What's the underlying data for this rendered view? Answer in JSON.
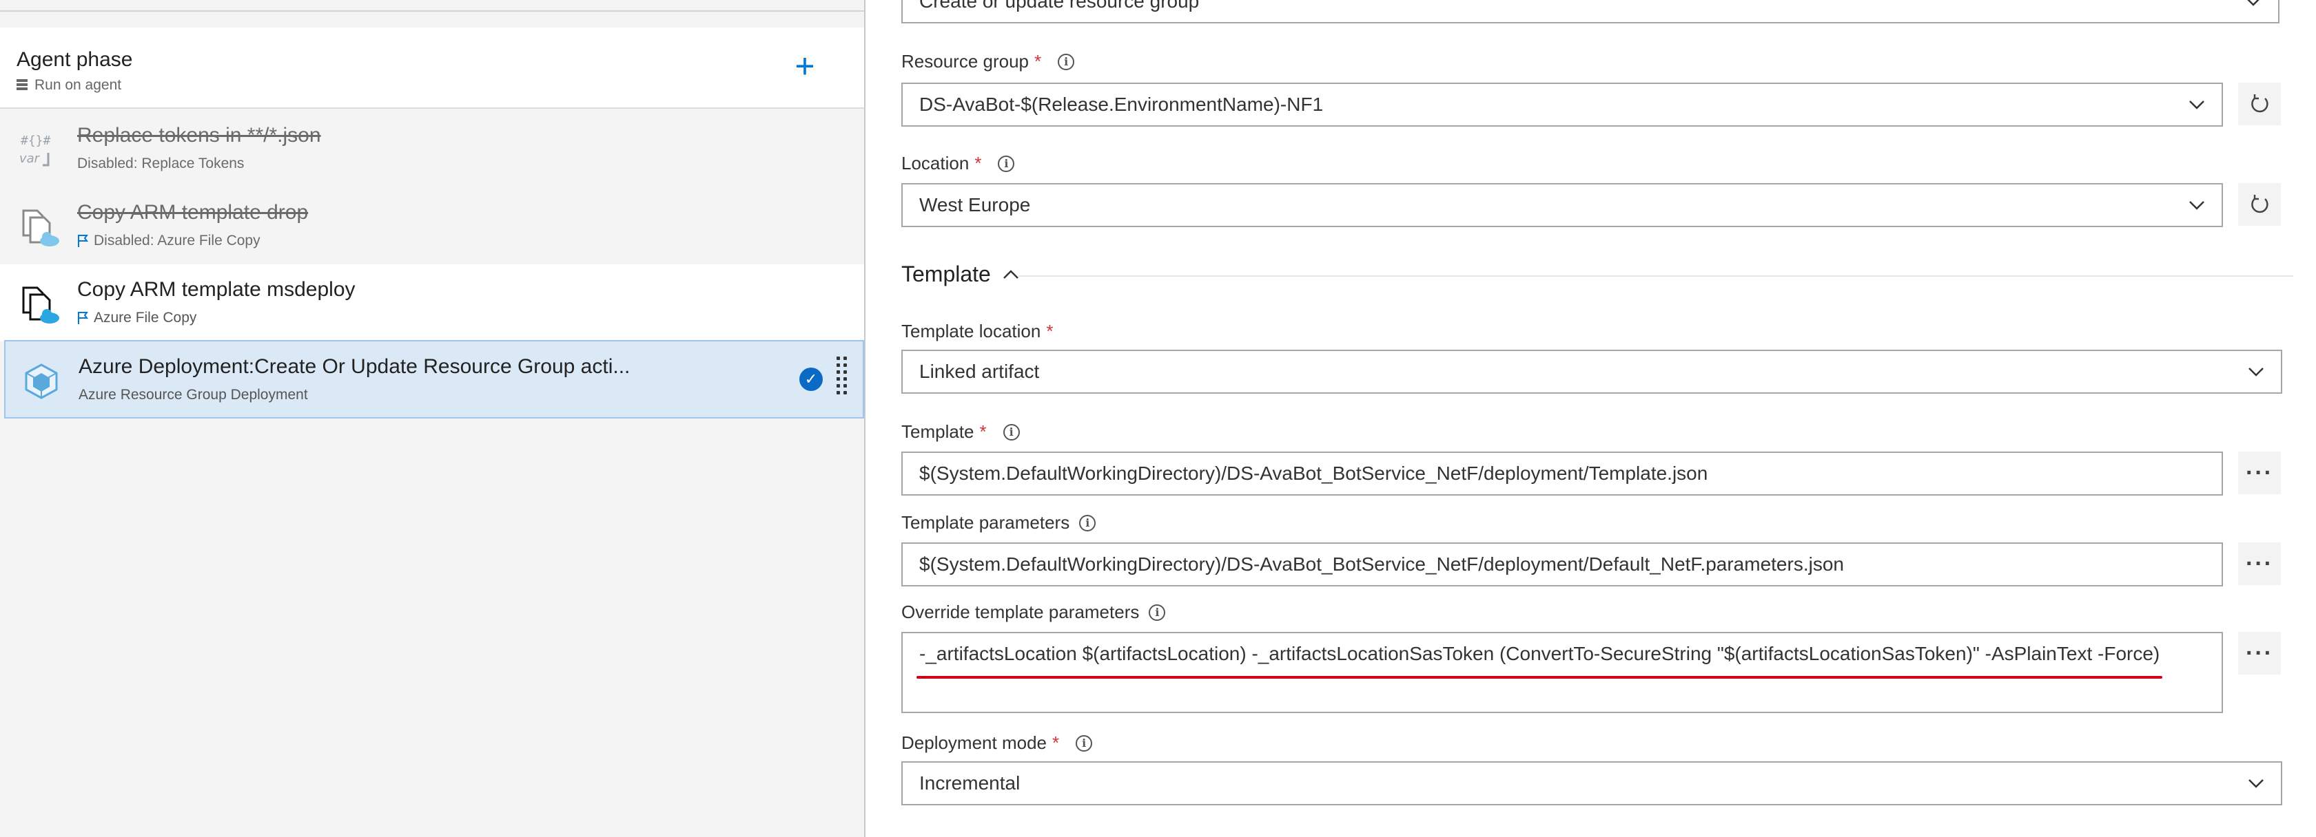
{
  "phase": {
    "title": "Agent phase",
    "subtitle": "Run on agent",
    "add_label": "+"
  },
  "tasks": [
    {
      "name": "Replace tokens in **/*.json",
      "sub": "Disabled: Replace Tokens",
      "icon": "replace-tokens-icon",
      "disabled": true
    },
    {
      "name": "Copy ARM template drop",
      "sub": "Disabled: Azure File Copy",
      "icon": "azure-file-copy-icon",
      "disabled": true
    },
    {
      "name": "Copy ARM template msdeploy",
      "sub": "Azure File Copy",
      "icon": "azure-file-copy-icon",
      "disabled": false
    },
    {
      "name": "Azure Deployment:Create Or Update Resource Group acti...",
      "sub": "Azure Resource Group Deployment",
      "icon": "azure-resource-group-icon",
      "selected": true
    }
  ],
  "form": {
    "action": {
      "value": "Create or update resource group"
    },
    "resource_group": {
      "label": "Resource group",
      "required": "*",
      "value": "DS-AvaBot-$(Release.EnvironmentName)-NF1"
    },
    "location": {
      "label": "Location",
      "required": "*",
      "value": "West Europe"
    },
    "template_section": {
      "title": "Template"
    },
    "template_location": {
      "label": "Template location",
      "required": "*",
      "value": "Linked artifact"
    },
    "template": {
      "label": "Template",
      "required": "*",
      "value": "$(System.DefaultWorkingDirectory)/DS-AvaBot_BotService_NetF/deployment/Template.json"
    },
    "template_parameters": {
      "label": "Template parameters",
      "value": "$(System.DefaultWorkingDirectory)/DS-AvaBot_BotService_NetF/deployment/Default_NetF.parameters.json"
    },
    "override_parameters": {
      "label": "Override template parameters",
      "value": "-_artifactsLocation $(artifactsLocation) -_artifactsLocationSasToken (ConvertTo-SecureString \"$(artifactsLocationSasToken)\" -AsPlainText -Force)"
    },
    "deployment_mode": {
      "label": "Deployment mode",
      "required": "*",
      "value": "Incremental"
    }
  },
  "ui": {
    "info_glyph": "i",
    "more_glyph": "···",
    "check_glyph": "✓",
    "accent_color": "#0078d4",
    "required_color": "#d13438",
    "annotation_color": "#d0021b"
  }
}
